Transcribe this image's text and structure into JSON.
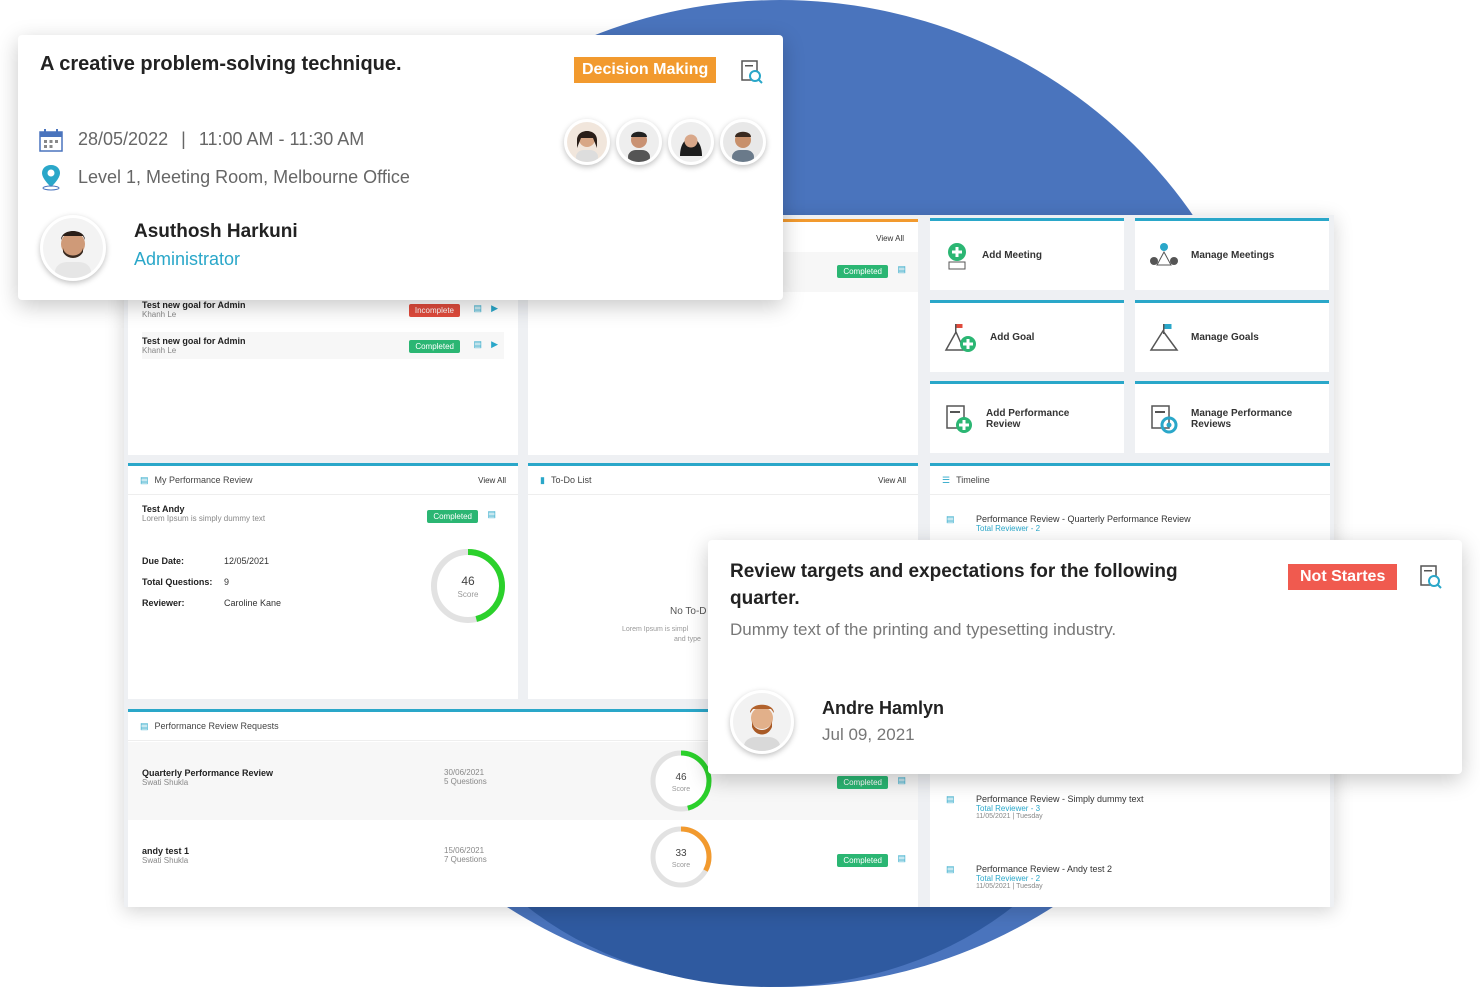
{
  "colors": {
    "accent": "#2aa7c9",
    "orange": "#f29a2e",
    "red": "#f05a4f",
    "green": "#2bb673",
    "blob": "#4a74bd"
  },
  "card_meeting": {
    "title": "A creative problem-solving technique.",
    "tag": "Decision Making",
    "date": "28/05/2022",
    "sep": "|",
    "time": "11:00 AM - 11:30 AM",
    "location": "Level 1, Meeting Room, Melbourne Office",
    "organizer_name": "Asuthosh Harkuni",
    "organizer_role": "Administrator",
    "icons": {
      "calendar": "calendar-icon",
      "location": "location-pin-icon",
      "search": "document-search-icon"
    }
  },
  "card_task": {
    "title_line1": "Review targets and expectations for the following",
    "title_line2": "quarter.",
    "status": "Not Startes",
    "description": "Dummy text of the printing and typesetting industry.",
    "person_name": "Andre Hamlyn",
    "date": "Jul 09, 2021"
  },
  "goals_panel": {
    "row1_title": "Test new goal for Admin",
    "row1_owner": "Khanh Le",
    "row1_status": "Incomplete",
    "row2_title": "Test new goal for Admin",
    "row2_owner": "Khanh Le",
    "row2_status": "Completed"
  },
  "meetings_panel": {
    "view_all": "View All",
    "status": "Completed"
  },
  "quick_actions": [
    {
      "label": "Add Meeting",
      "icon": "add-meeting-icon"
    },
    {
      "label": "Manage Meetings",
      "icon": "manage-meetings-icon"
    },
    {
      "label": "Add Goal",
      "icon": "add-goal-icon"
    },
    {
      "label": "Manage Goals",
      "icon": "manage-goals-icon"
    },
    {
      "label": "Add Performance Review",
      "icon": "add-review-icon"
    },
    {
      "label": "Manage Performance Reviews",
      "icon": "manage-reviews-icon"
    }
  ],
  "my_review": {
    "title": "My Performance Review",
    "view_all": "View All",
    "name": "Test Andy",
    "desc": "Lorem Ipsum is simply dummy text",
    "status": "Completed",
    "due_label": "Due Date:",
    "due_value": "12/05/2021",
    "questions_label": "Total Questions:",
    "questions_value": "9",
    "reviewer_label": "Reviewer:",
    "reviewer_value": "Caroline Kane",
    "score": "46",
    "score_label": "Score",
    "score_fraction": 0.46
  },
  "todo": {
    "title": "To-Do List",
    "view_all": "View All",
    "empty": "No To-D",
    "empty_sub1": "Lorem Ipsum is simpl",
    "empty_sub2": "and type"
  },
  "timeline": {
    "title": "Timeline",
    "items": [
      {
        "title": "Performance Review - Quarterly Performance Review",
        "link": "Total Reviewer - 2",
        "date": ""
      },
      {
        "title": "Performance Review - Simply dummy text",
        "link": "Total Reviewer - 3",
        "date": "11/05/2021 | Tuesday"
      },
      {
        "title": "Performance Review - Andy test 2",
        "link": "Total Reviewer - 2",
        "date": "11/05/2021 | Tuesday"
      }
    ]
  },
  "requests": {
    "title": "Performance Review Requests",
    "rows": [
      {
        "name": "Quarterly Performance Review",
        "owner": "Swati Shukla",
        "date": "30/06/2021",
        "questions": "5 Questions",
        "score": "46",
        "score_label": "Score",
        "status": "Completed",
        "fraction": 0.46,
        "ring_color": "#2bd12b"
      },
      {
        "name": "andy test 1",
        "owner": "Swati Shukla",
        "date": "15/06/2021",
        "questions": "7 Questions",
        "score": "33",
        "score_label": "Score",
        "status": "Completed",
        "fraction": 0.33,
        "ring_color": "#f29a2e"
      }
    ]
  }
}
